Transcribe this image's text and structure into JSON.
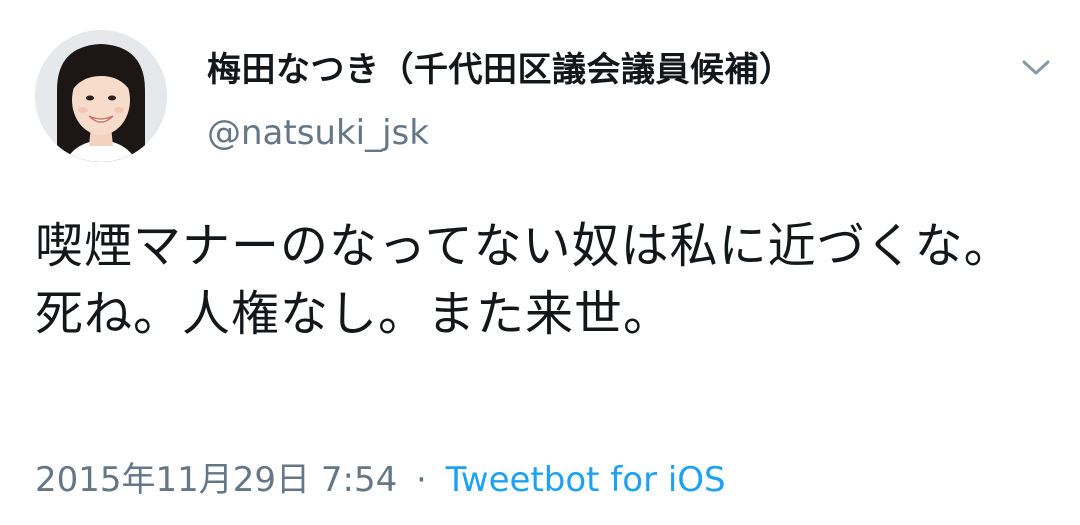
{
  "tweet": {
    "author": {
      "display_name": "梅田なつき（千代田区議会議員候補）",
      "handle": "@natsuki_jsk",
      "avatar": "profile-photo"
    },
    "text": "喫煙マナーのなってない奴は私に近づくな。死ね。人権なし。また来世。",
    "timestamp": "2015年11月29日 7:54",
    "separator": "·",
    "source": "Tweetbot for iOS",
    "menu_icon": "chevron-down-icon"
  },
  "colors": {
    "text_primary": "#14171a",
    "text_secondary": "#657786",
    "link": "#1da1f2",
    "background": "#ffffff"
  }
}
